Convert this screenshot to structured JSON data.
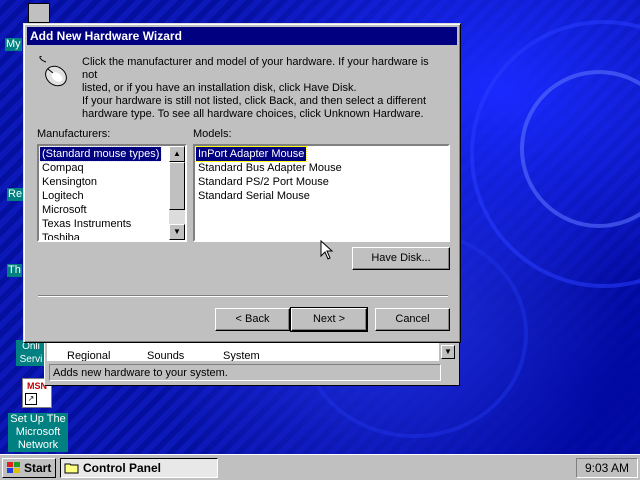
{
  "desktop": {
    "icons": [
      {
        "label": "My"
      },
      {
        "label": "Re"
      },
      {
        "label": "Th"
      },
      {
        "label": "Onli Servi"
      },
      {
        "label": "Set Up The Microsoft Network",
        "line1": "Set Up The",
        "line2": "Microsoft",
        "line3": "Network"
      }
    ],
    "msn_logo_text": "MSN"
  },
  "control_panel": {
    "icons": [
      "Regional",
      "Sounds",
      "System"
    ],
    "status_text": "Adds new hardware to your system."
  },
  "wizard": {
    "title": "Add New Hardware Wizard",
    "intro_text": "Click the manufacturer and model of your hardware. If your hardware is not listed, or if you have an installation disk, click Have Disk.",
    "intro_text_line1": "Click the manufacturer and model of your hardware. If your hardware is not",
    "intro_text_line2": "listed, or if you have an installation disk, click Have Disk.",
    "help_text_line1": "If your hardware is still not listed, click Back, and then select a different",
    "help_text_line2": "hardware type. To see all hardware choices, click Unknown Hardware.",
    "manufacturers_label": "Manufacturers:",
    "models_label": "Models:",
    "manufacturers": [
      "(Standard mouse types)",
      "Compaq",
      "Kensington",
      "Logitech",
      "Microsoft",
      "Texas Instruments",
      "Toshiba"
    ],
    "selected_manufacturer": "(Standard mouse types)",
    "models": [
      "InPort Adapter Mouse",
      "Standard Bus Adapter Mouse",
      "Standard PS/2 Port Mouse",
      "Standard Serial Mouse"
    ],
    "selected_model": "InPort Adapter Mouse",
    "have_disk_label": "Have Disk...",
    "back_label": "< Back",
    "next_label": "Next >",
    "cancel_label": "Cancel"
  },
  "taskbar": {
    "start_label": "Start",
    "task_label": "Control Panel",
    "clock": "9:03 AM"
  }
}
